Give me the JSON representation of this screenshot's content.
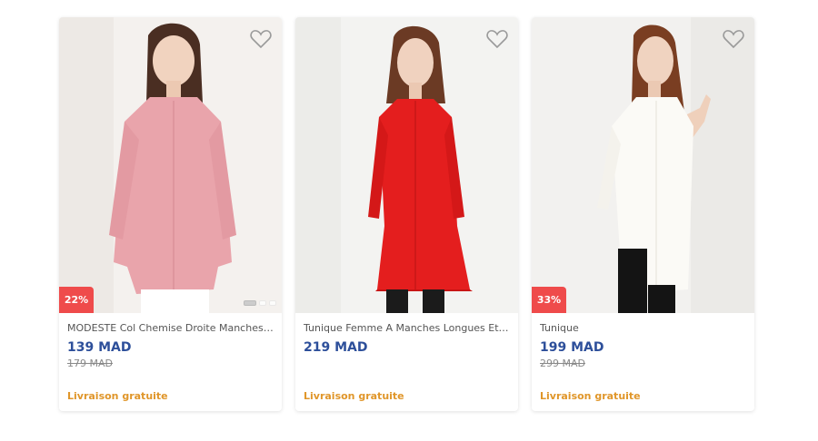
{
  "products": [
    {
      "title": "MODESTE Col Chemise Droite Manches L...",
      "price": "139 MAD",
      "old_price": "179 MAD",
      "discount": "22%",
      "shipping": "Livraison gratuite",
      "image_icon": "pink-tunic-model"
    },
    {
      "title": "Tunique Femme A Manches Longues Et C...",
      "price": "219 MAD",
      "old_price": "",
      "discount": "",
      "shipping": "Livraison gratuite",
      "image_icon": "red-tunic-model"
    },
    {
      "title": "Tunique",
      "price": "199 MAD",
      "old_price": "299 MAD",
      "discount": "33%",
      "shipping": "Livraison gratuite",
      "image_icon": "white-tunic-model"
    }
  ],
  "colors": {
    "price": "#2d4f9a",
    "badge": "#ef4b4b",
    "shipping": "#e0962a"
  }
}
